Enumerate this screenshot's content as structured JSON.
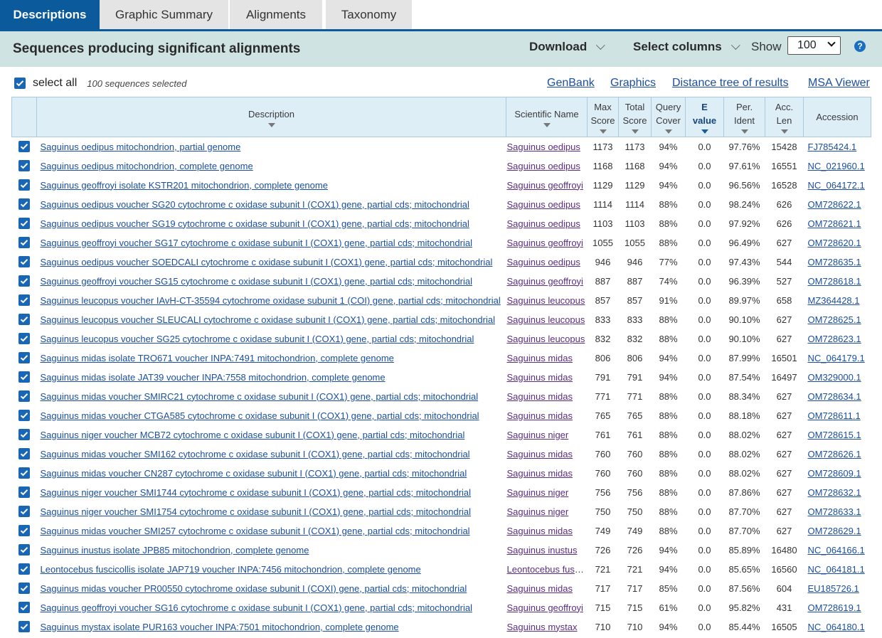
{
  "tabs": [
    "Descriptions",
    "Graphic Summary",
    "Alignments",
    "Taxonomy"
  ],
  "header": {
    "title": "Sequences producing significant alignments",
    "download_label": "Download",
    "select_columns_label": "Select columns",
    "show_label": "Show",
    "show_value": "100",
    "help_icon": "?"
  },
  "selection": {
    "select_all_label": "select all",
    "count_text": "100 sequences selected"
  },
  "links": [
    "GenBank",
    "Graphics",
    "Distance tree of results",
    "MSA Viewer"
  ],
  "columns": {
    "description": "Description",
    "scientific_name": "Scientific Name",
    "max_score_1": "Max",
    "max_score_2": "Score",
    "total_score_1": "Total",
    "total_score_2": "Score",
    "query_cover_1": "Query",
    "query_cover_2": "Cover",
    "evalue_1": "E",
    "evalue_2": "value",
    "per_ident_1": "Per.",
    "per_ident_2": "Ident",
    "acc_len_1": "Acc.",
    "acc_len_2": "Len",
    "accession": "Accession"
  },
  "rows": [
    {
      "description": "Saguinus oedipus mitochondrion, partial genome",
      "scientific_name": "Saguinus oedipus",
      "max_score": "1173",
      "total_score": "1173",
      "query_cover": "94%",
      "evalue": "0.0",
      "per_ident": "97.76%",
      "acc_len": "15428",
      "accession": "FJ785424.1"
    },
    {
      "description": "Saguinus oedipus mitochondrion, complete genome",
      "scientific_name": "Saguinus oedipus",
      "max_score": "1168",
      "total_score": "1168",
      "query_cover": "94%",
      "evalue": "0.0",
      "per_ident": "97.61%",
      "acc_len": "16551",
      "accession": "NC_021960.1"
    },
    {
      "description": "Saguinus geoffroyi isolate KSTR201 mitochondrion, complete genome",
      "scientific_name": "Saguinus geoffroyi",
      "max_score": "1129",
      "total_score": "1129",
      "query_cover": "94%",
      "evalue": "0.0",
      "per_ident": "96.56%",
      "acc_len": "16528",
      "accession": "NC_064172.1"
    },
    {
      "description": "Saguinus oedipus voucher SG20 cytochrome c oxidase subunit I (COX1) gene, partial cds; mitochondrial",
      "scientific_name": "Saguinus oedipus",
      "max_score": "1114",
      "total_score": "1114",
      "query_cover": "88%",
      "evalue": "0.0",
      "per_ident": "98.24%",
      "acc_len": "626",
      "accession": "OM728622.1"
    },
    {
      "description": "Saguinus oedipus voucher SG19 cytochrome c oxidase subunit I (COX1) gene, partial cds; mitochondrial",
      "scientific_name": "Saguinus oedipus",
      "max_score": "1103",
      "total_score": "1103",
      "query_cover": "88%",
      "evalue": "0.0",
      "per_ident": "97.92%",
      "acc_len": "626",
      "accession": "OM728621.1"
    },
    {
      "description": "Saguinus geoffroyi voucher SG17 cytochrome c oxidase subunit I (COX1) gene, partial cds; mitochondrial",
      "scientific_name": "Saguinus geoffroyi",
      "max_score": "1055",
      "total_score": "1055",
      "query_cover": "88%",
      "evalue": "0.0",
      "per_ident": "96.49%",
      "acc_len": "627",
      "accession": "OM728620.1"
    },
    {
      "description": "Saguinus oedipus voucher SOEDCALI cytochrome c oxidase subunit I (COX1) gene, partial cds; mitochondrial",
      "scientific_name": "Saguinus oedipus",
      "max_score": "946",
      "total_score": "946",
      "query_cover": "77%",
      "evalue": "0.0",
      "per_ident": "97.43%",
      "acc_len": "544",
      "accession": "OM728635.1"
    },
    {
      "description": "Saguinus geoffroyi voucher SG15 cytochrome c oxidase subunit I (COX1) gene, partial cds; mitochondrial",
      "scientific_name": "Saguinus geoffroyi",
      "max_score": "887",
      "total_score": "887",
      "query_cover": "74%",
      "evalue": "0.0",
      "per_ident": "96.39%",
      "acc_len": "527",
      "accession": "OM728618.1"
    },
    {
      "description": "Saguinus leucopus voucher IAvH-CT-35594 cytochrome oxidase subunit 1 (COI) gene, partial cds; mitochondrial",
      "scientific_name": "Saguinus leucopus",
      "max_score": "857",
      "total_score": "857",
      "query_cover": "91%",
      "evalue": "0.0",
      "per_ident": "89.97%",
      "acc_len": "658",
      "accession": "MZ364428.1"
    },
    {
      "description": "Saguinus leucopus voucher SLEUCALI cytochrome c oxidase subunit I (COX1) gene, partial cds; mitochondrial",
      "scientific_name": "Saguinus leucopus",
      "max_score": "833",
      "total_score": "833",
      "query_cover": "88%",
      "evalue": "0.0",
      "per_ident": "90.10%",
      "acc_len": "627",
      "accession": "OM728625.1"
    },
    {
      "description": "Saguinus leucopus voucher SG25 cytochrome c oxidase subunit I (COX1) gene, partial cds; mitochondrial",
      "scientific_name": "Saguinus leucopus",
      "max_score": "832",
      "total_score": "832",
      "query_cover": "88%",
      "evalue": "0.0",
      "per_ident": "90.10%",
      "acc_len": "627",
      "accession": "OM728623.1"
    },
    {
      "description": "Saguinus midas isolate TRO671 voucher INPA:7491 mitochondrion, complete genome",
      "scientific_name": "Saguinus midas",
      "max_score": "806",
      "total_score": "806",
      "query_cover": "94%",
      "evalue": "0.0",
      "per_ident": "87.99%",
      "acc_len": "16501",
      "accession": "NC_064179.1"
    },
    {
      "description": "Saguinus midas isolate JAT39 voucher INPA:7558 mitochondrion, complete genome",
      "scientific_name": "Saguinus midas",
      "max_score": "791",
      "total_score": "791",
      "query_cover": "94%",
      "evalue": "0.0",
      "per_ident": "87.54%",
      "acc_len": "16497",
      "accession": "OM329000.1"
    },
    {
      "description": "Saguinus midas voucher SMIRC21 cytochrome c oxidase subunit I (COX1) gene, partial cds; mitochondrial",
      "scientific_name": "Saguinus midas",
      "max_score": "771",
      "total_score": "771",
      "query_cover": "88%",
      "evalue": "0.0",
      "per_ident": "88.34%",
      "acc_len": "627",
      "accession": "OM728634.1"
    },
    {
      "description": "Saguinus midas voucher CTGA585 cytochrome c oxidase subunit I (COX1) gene, partial cds; mitochondrial",
      "scientific_name": "Saguinus midas",
      "max_score": "765",
      "total_score": "765",
      "query_cover": "88%",
      "evalue": "0.0",
      "per_ident": "88.18%",
      "acc_len": "627",
      "accession": "OM728611.1"
    },
    {
      "description": "Saguinus niger voucher MCB72 cytochrome c oxidase subunit I (COX1) gene, partial cds; mitochondrial",
      "scientific_name": "Saguinus niger",
      "max_score": "761",
      "total_score": "761",
      "query_cover": "88%",
      "evalue": "0.0",
      "per_ident": "88.02%",
      "acc_len": "627",
      "accession": "OM728615.1"
    },
    {
      "description": "Saguinus midas voucher SMI162 cytochrome c oxidase subunit I (COX1) gene, partial cds; mitochondrial",
      "scientific_name": "Saguinus midas",
      "max_score": "760",
      "total_score": "760",
      "query_cover": "88%",
      "evalue": "0.0",
      "per_ident": "88.02%",
      "acc_len": "627",
      "accession": "OM728626.1"
    },
    {
      "description": "Saguinus midas voucher CN287 cytochrome c oxidase subunit I (COX1) gene, partial cds; mitochondrial",
      "scientific_name": "Saguinus midas",
      "max_score": "760",
      "total_score": "760",
      "query_cover": "88%",
      "evalue": "0.0",
      "per_ident": "88.02%",
      "acc_len": "627",
      "accession": "OM728609.1"
    },
    {
      "description": "Saguinus niger voucher SMI1744 cytochrome c oxidase subunit I (COX1) gene, partial cds; mitochondrial",
      "scientific_name": "Saguinus niger",
      "max_score": "756",
      "total_score": "756",
      "query_cover": "88%",
      "evalue": "0.0",
      "per_ident": "87.86%",
      "acc_len": "627",
      "accession": "OM728632.1"
    },
    {
      "description": "Saguinus niger voucher SMI1754 cytochrome c oxidase subunit I (COX1) gene, partial cds; mitochondrial",
      "scientific_name": "Saguinus niger",
      "max_score": "750",
      "total_score": "750",
      "query_cover": "88%",
      "evalue": "0.0",
      "per_ident": "87.70%",
      "acc_len": "627",
      "accession": "OM728633.1"
    },
    {
      "description": "Saguinus midas voucher SMI257 cytochrome c oxidase subunit I (COX1) gene, partial cds; mitochondrial",
      "scientific_name": "Saguinus midas",
      "max_score": "749",
      "total_score": "749",
      "query_cover": "88%",
      "evalue": "0.0",
      "per_ident": "87.70%",
      "acc_len": "627",
      "accession": "OM728629.1"
    },
    {
      "description": "Saguinus inustus isolate JPB85 mitochondrion, complete genome",
      "scientific_name": "Saguinus inustus",
      "max_score": "726",
      "total_score": "726",
      "query_cover": "94%",
      "evalue": "0.0",
      "per_ident": "85.89%",
      "acc_len": "16480",
      "accession": "NC_064166.1"
    },
    {
      "description": "Leontocebus fuscicollis isolate JAP719 voucher INPA:7456 mitochondrion, complete genome",
      "scientific_name": "Leontocebus fuscicollis",
      "max_score": "721",
      "total_score": "721",
      "query_cover": "94%",
      "evalue": "0.0",
      "per_ident": "85.65%",
      "acc_len": "16560",
      "accession": "NC_064181.1"
    },
    {
      "description": "Saguinus midas voucher PR00550 cytochrome oxidase subunit I (COXI) gene, partial cds; mitochondrial",
      "scientific_name": "Saguinus midas",
      "max_score": "717",
      "total_score": "717",
      "query_cover": "85%",
      "evalue": "0.0",
      "per_ident": "87.56%",
      "acc_len": "604",
      "accession": "EU185726.1"
    },
    {
      "description": "Saguinus geoffroyi voucher SG16 cytochrome c oxidase subunit I (COX1) gene, partial cds; mitochondrial",
      "scientific_name": "Saguinus geoffroyi",
      "max_score": "715",
      "total_score": "715",
      "query_cover": "61%",
      "evalue": "0.0",
      "per_ident": "95.82%",
      "acc_len": "431",
      "accession": "OM728619.1"
    },
    {
      "description": "Saguinus mystax isolate PUR163 voucher INPA:7501 mitochondrion, complete genome",
      "scientific_name": "Saguinus mystax",
      "max_score": "710",
      "total_score": "710",
      "query_cover": "94%",
      "evalue": "0.0",
      "per_ident": "85.44%",
      "acc_len": "16505",
      "accession": "NC_064180.1"
    }
  ]
}
